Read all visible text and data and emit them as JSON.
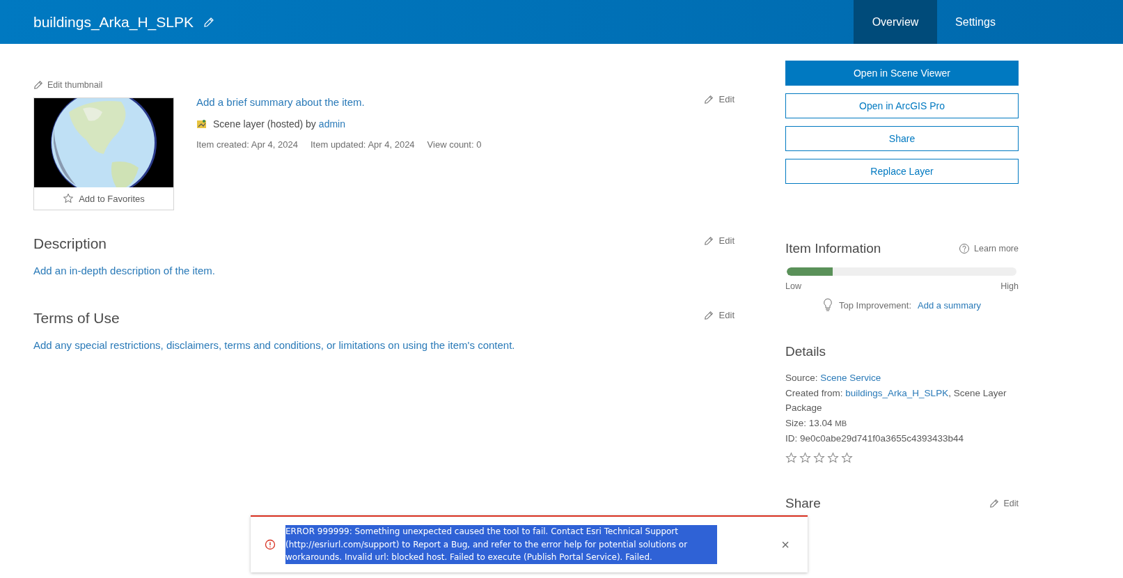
{
  "header": {
    "title": "buildings_Arka_H_SLPK",
    "tabs": [
      {
        "label": "Overview",
        "selected": true
      },
      {
        "label": "Settings",
        "selected": false
      }
    ]
  },
  "thumbnail": {
    "edit_label": "Edit thumbnail",
    "kind": "picture",
    "favorite_label": "Add to Favorites"
  },
  "summary": {
    "text": "Add a brief summary about the item.",
    "edit_label": "Edit",
    "type_text": "Scene layer (hosted) by",
    "owner": "admin",
    "meta": [
      "Item created: Apr 4, 2024",
      "Item updated: Apr 4, 2024",
      "View count: 0"
    ]
  },
  "sections": [
    {
      "title": "Description",
      "edit_label": "Edit",
      "text": "Add an in-depth description of the item."
    },
    {
      "title": "Terms of Use",
      "edit_label": "Edit",
      "text": "Add any special restrictions, disclaimers, terms and conditions, or limitations on using the item's content."
    }
  ],
  "actions": [
    {
      "label": "Open in Scene Viewer",
      "kind": "primary"
    },
    {
      "label": "Open in ArcGIS Pro",
      "kind": "outline"
    },
    {
      "label": "Share",
      "kind": "outline"
    },
    {
      "label": "Replace Layer",
      "kind": "outline"
    }
  ],
  "item_information": {
    "title": "Item Information",
    "learn_more": "Learn more",
    "level": 0.2,
    "low": "Low",
    "high": "High",
    "improvement_label": "Top Improvement:",
    "improvement_link": "Add a summary"
  },
  "details": {
    "title": "Details",
    "source_label": "Source:",
    "source_link": "Scene Service",
    "created_label": "Created from:",
    "created_link": "buildings_Arka_H_SLPK",
    "created_rest": ", Scene Layer Package",
    "size_label": "Size: 13.04",
    "size_unit": "MB",
    "id": "ID: 9e0c0abe29d741f0a3655c4393433b44",
    "stars": 0
  },
  "share": {
    "title": "Share",
    "edit_label": "Edit"
  },
  "toast": {
    "message": "ERROR 999999: Something unexpected caused the tool to fail. Contact Esri Technical Support (http://esriurl.com/support) to Report a Bug, and refer to the error help for potential solutions or workarounds. Invalid url: blocked host. Failed to execute (Publish Portal Service). Failed.",
    "close": "×"
  }
}
